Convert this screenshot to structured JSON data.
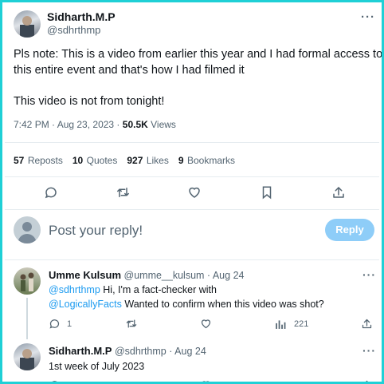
{
  "main_tweet": {
    "author_name": "Sidharth.M.P",
    "author_handle": "@sdhrthmp",
    "text_line1": "Pls note: This is a video from earlier this year and I had formal access to",
    "text_line2": "this entire event and that's how I had filmed it",
    "text_line3": "This video is not from tonight!",
    "time": "7:42 PM · Aug 23, 2023 · ",
    "views_count": "50.5K",
    "views_label": " Views",
    "stats": {
      "reposts_count": "57",
      "reposts_label": "Reposts",
      "quotes_count": "10",
      "quotes_label": "Quotes",
      "likes_count": "927",
      "likes_label": "Likes",
      "bookmarks_count": "9",
      "bookmarks_label": "Bookmarks"
    },
    "more": "···"
  },
  "compose": {
    "placeholder": "Post your reply!",
    "button_label": "Reply"
  },
  "replies": [
    {
      "author_name": "Umme Kulsum",
      "author_handle": "@umme__kulsum · Aug 24",
      "mention1": "@sdhrthmp",
      "text1": " Hi, I'm a fact-checker with",
      "mention2": "@LogicallyFacts",
      "text2": " Wanted to confirm when this video was shot?",
      "reply_count": "1",
      "views_count": "221",
      "more": "···"
    },
    {
      "author_name": "Sidharth.M.P",
      "author_handle": "@sdhrthmp · Aug 24",
      "text": "1st week of July 2023",
      "more": "···"
    }
  ],
  "colors": {
    "accent": "#1d9bf0",
    "reply_button": "#8ecdf8",
    "border": "#1fd0d6",
    "muted": "#536471"
  },
  "icons": [
    "reply-icon",
    "repost-icon",
    "like-icon",
    "bookmark-icon",
    "share-icon",
    "views-icon",
    "default-avatar-icon"
  ]
}
